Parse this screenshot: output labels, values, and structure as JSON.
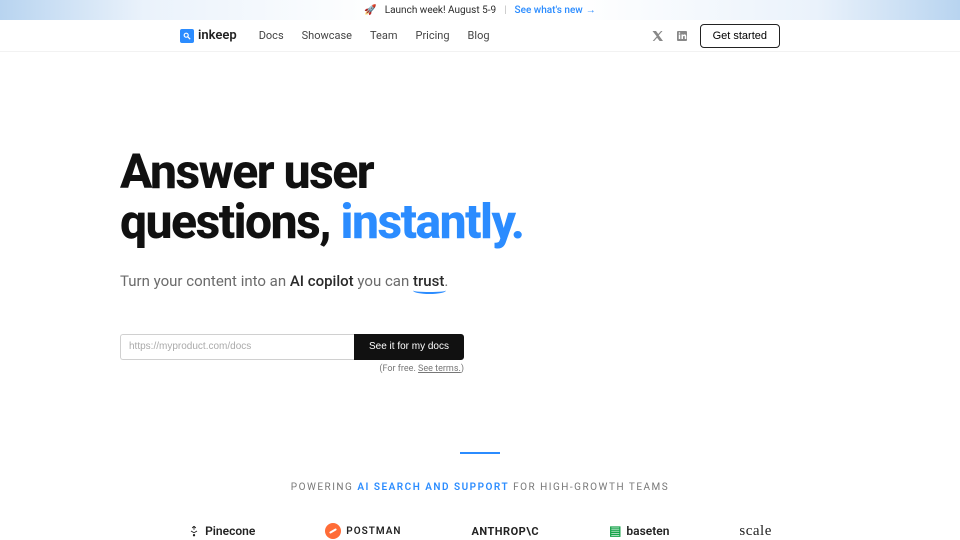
{
  "banner": {
    "text": "Launch week! August 5-9",
    "link": "See what's new"
  },
  "nav": {
    "brand": "inkeep",
    "links": [
      "Docs",
      "Showcase",
      "Team",
      "Pricing",
      "Blog"
    ],
    "cta": "Get started"
  },
  "hero": {
    "title_a": "Answer user",
    "title_b": "questions, ",
    "title_accent": "instantly.",
    "sub_pre": "Turn your content into an ",
    "sub_mid": "AI copilot",
    "sub_mid2": " you can ",
    "sub_trust": "trust",
    "sub_post": "."
  },
  "cta": {
    "placeholder": "https://myproduct.com/docs",
    "button": "See it for my docs",
    "disclaimer_pre": "(For free. ",
    "disclaimer_link": "See terms.",
    "disclaimer_post": ")"
  },
  "powering": {
    "pre": "POWERING ",
    "accent": "AI SEARCH AND SUPPORT",
    "post": " FOR HIGH-GROWTH TEAMS"
  },
  "logos": {
    "pinecone": "Pinecone",
    "postman": "POSTMAN",
    "anthropic": "ANTHROP\\C",
    "baseten": "baseten",
    "scale": "scale"
  }
}
